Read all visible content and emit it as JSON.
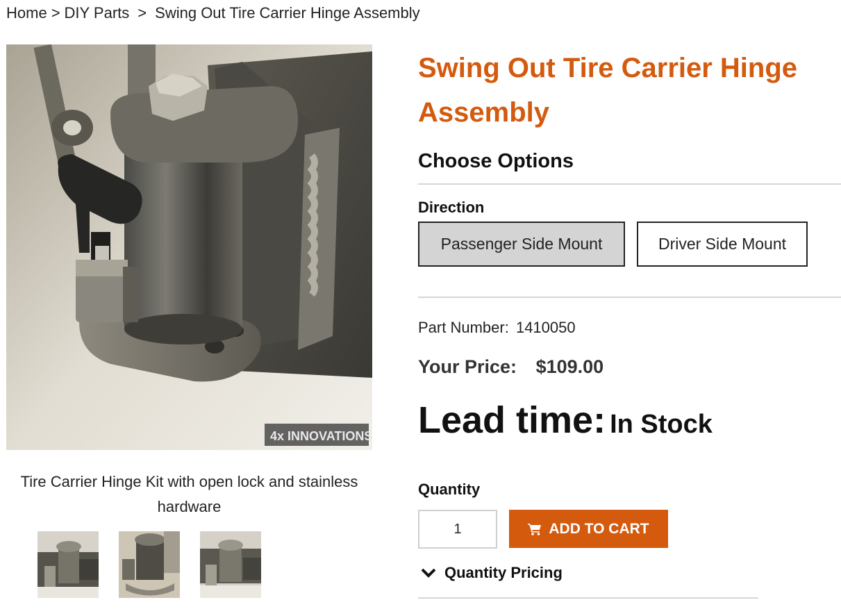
{
  "breadcrumb": {
    "home": "Home",
    "sep1": ">",
    "category": "DIY Parts",
    "sep2": ">",
    "current": "Swing Out Tire Carrier Hinge Assembly"
  },
  "gallery": {
    "watermark": "4x INNOVATIONS",
    "caption": "Tire Carrier Hinge Kit with open lock and stainless hardware",
    "thumbnails": [
      "thumb-1",
      "thumb-2",
      "thumb-3"
    ]
  },
  "product": {
    "title": "Swing Out Tire Carrier Hinge Assembly",
    "options_heading": "Choose Options",
    "direction_label": "Direction",
    "options": [
      {
        "label": "Passenger Side Mount",
        "selected": true
      },
      {
        "label": "Driver Side Mount",
        "selected": false
      }
    ],
    "part_number_label": "Part Number:",
    "part_number": "1410050",
    "price_label": "Your Price:",
    "price": "$109.00",
    "lead_time_label": "Lead time:",
    "lead_time": "In Stock",
    "quantity_label": "Quantity",
    "quantity_value": "1",
    "add_to_cart": "ADD TO CART",
    "quantity_pricing": "Quantity Pricing"
  },
  "colors": {
    "accent": "#d45a0e",
    "selected_option_bg": "#d4d4d4",
    "divider": "#d6d6d6"
  },
  "icons": {
    "cart": "shopping-cart-icon",
    "chevron": "chevron-down-icon"
  }
}
